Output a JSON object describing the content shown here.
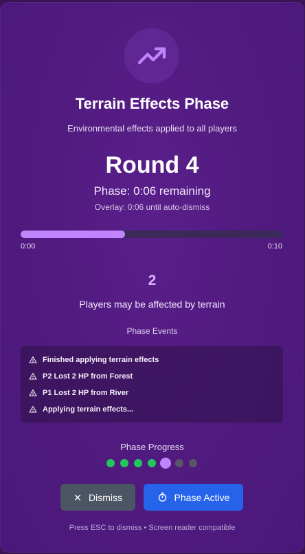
{
  "header": {
    "icon": "trending-up-icon",
    "title": "Terrain Effects Phase",
    "subtitle": "Environmental effects applied to all players"
  },
  "round": {
    "label": "Round 4",
    "phase_remaining": "Phase: 0:06 remaining",
    "overlay_remaining": "Overlay: 0:06 until auto-dismiss"
  },
  "timer": {
    "progress": 0.4,
    "start_label": "0:00",
    "end_label": "0:10",
    "fill_color": "#c084fc"
  },
  "affected": {
    "count": "2",
    "label": "Players may be affected by terrain"
  },
  "events": {
    "heading": "Phase Events",
    "items": [
      {
        "icon": "warning-icon",
        "text": "Finished applying terrain effects"
      },
      {
        "icon": "warning-icon",
        "text": "P2 Lost 2 HP from Forest"
      },
      {
        "icon": "warning-icon",
        "text": "P1 Lost 2 HP from River"
      },
      {
        "icon": "warning-icon",
        "text": "Applying terrain effects..."
      }
    ]
  },
  "phase_progress": {
    "heading": "Phase Progress",
    "total_steps": 7,
    "completed_steps": 4,
    "current_step": 5,
    "colors": {
      "done": "#22c55e",
      "current": "#c084fc",
      "pending": "#5b5568"
    }
  },
  "buttons": {
    "dismiss": {
      "icon": "close-icon",
      "label": "Dismiss"
    },
    "phase_active": {
      "icon": "stopwatch-icon",
      "label": "Phase Active"
    }
  },
  "footer": "Press ESC to dismiss • Screen reader compatible"
}
